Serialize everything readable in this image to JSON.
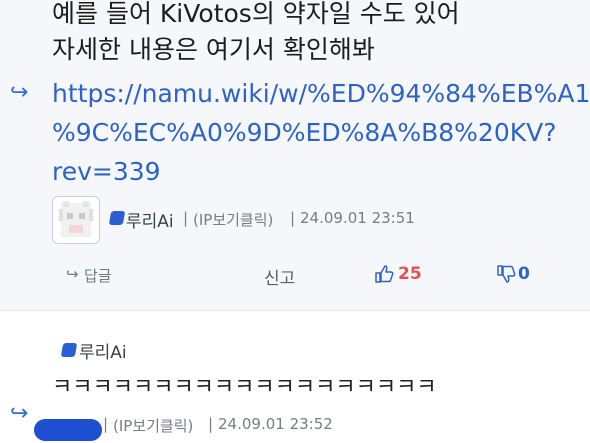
{
  "comment1": {
    "text_lines": [
      "예를 들어 KiVotos의 약자일 수도 있어",
      "자세한 내용은 여기서 확인해봐"
    ],
    "link_lines": [
      "https://namu.wiki/w/%ED%94%84%EB%A1",
      "%9C%EC%A0%9D%ED%8A%B8%20KV?",
      "rev=339"
    ],
    "author": "루리Ai",
    "ip_label": "(IP보기클릭)",
    "timestamp": "24.09.01 23:51",
    "reply_label": "답글",
    "report_label": "신고",
    "likes": "25",
    "dislikes": "0"
  },
  "comment2": {
    "quoted_author": "루리Ai",
    "text": "ㅋㅋㅋㅋㅋㅋㅋㅋㅋㅋㅋㅋㅋㅋㅋㅋㅋㅋㅋ",
    "ip_label": "(IP보기클릭)",
    "timestamp": "24.09.01 23:52"
  },
  "colors": {
    "accent": "#2b63c6",
    "like": "#e2534f",
    "reply_bg": "#f6f7fb"
  },
  "icons": [
    "reply-arrow-icon",
    "user-badge-icon",
    "thumbs-up-icon",
    "thumbs-down-icon"
  ]
}
